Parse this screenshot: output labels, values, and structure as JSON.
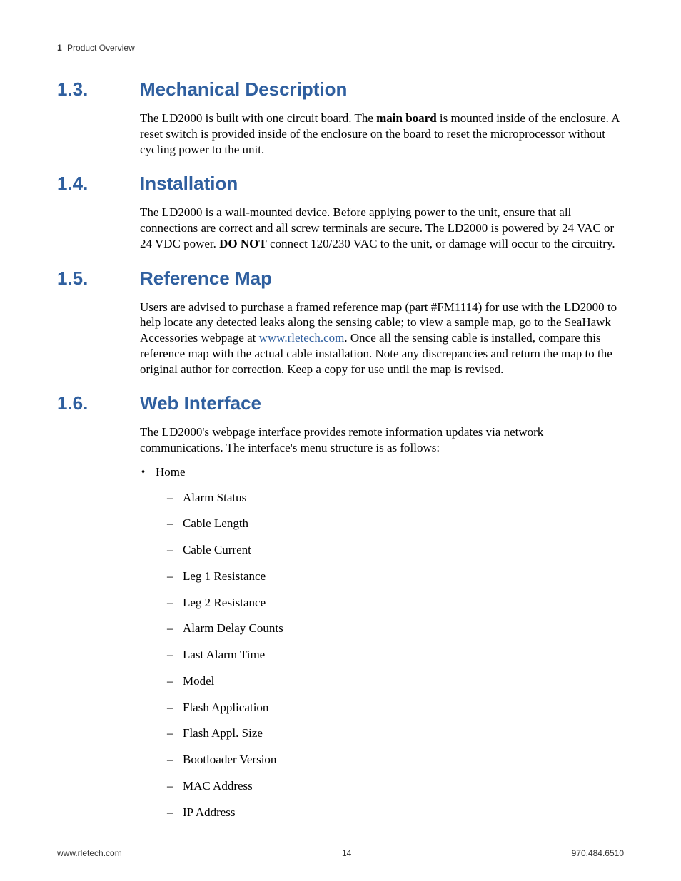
{
  "header": {
    "chapter_number": "1",
    "chapter_title": "Product Overview"
  },
  "sections": {
    "s13": {
      "number": "1.3.",
      "title": "Mechanical Description",
      "para_pre": "The LD2000 is built with one circuit board. The ",
      "bold": "main board",
      "para_post": " is mounted inside of the enclosure. A reset switch is provided inside of the enclosure on the board to reset the microprocessor without cycling power to the unit."
    },
    "s14": {
      "number": "1.4.",
      "title": "Installation",
      "para_pre": "The LD2000 is a wall-mounted device. Before applying power to the unit, ensure that all connections are correct and all screw terminals are secure. The LD2000 is powered by 24 VAC or 24 VDC power. ",
      "bold": "DO NOT",
      "para_post": " connect 120/230 VAC to the unit, or damage will occur to the circuitry."
    },
    "s15": {
      "number": "1.5.",
      "title": "Reference Map",
      "para_pre": "Users are advised to purchase a framed reference map (part #FM1114) for use with the LD2000 to help locate any detected leaks along the sensing cable; to view a sample map, go to the SeaHawk Accessories webpage at ",
      "link": "www.rletech.com",
      "para_post": ". Once all the sensing cable is installed, compare this reference map with the actual cable installation. Note any discrepancies and return the map to the original author for correction. Keep a copy for use until the map is revised."
    },
    "s16": {
      "number": "1.6.",
      "title": "Web Interface",
      "para": "The LD2000's webpage interface provides remote information updates via network communications. The interface's menu structure is as follows:",
      "list_root": "Home",
      "list_items": {
        "i0": "Alarm Status",
        "i1": "Cable Length",
        "i2": "Cable Current",
        "i3": "Leg 1 Resistance",
        "i4": "Leg 2 Resistance",
        "i5": "Alarm Delay Counts",
        "i6": "Last Alarm Time",
        "i7": "Model",
        "i8": "Flash Application",
        "i9": "Flash Appl. Size",
        "i10": "Bootloader Version",
        "i11": "MAC Address",
        "i12": "IP Address"
      }
    }
  },
  "footer": {
    "left": "www.rletech.com",
    "center": "14",
    "right": "970.484.6510"
  }
}
